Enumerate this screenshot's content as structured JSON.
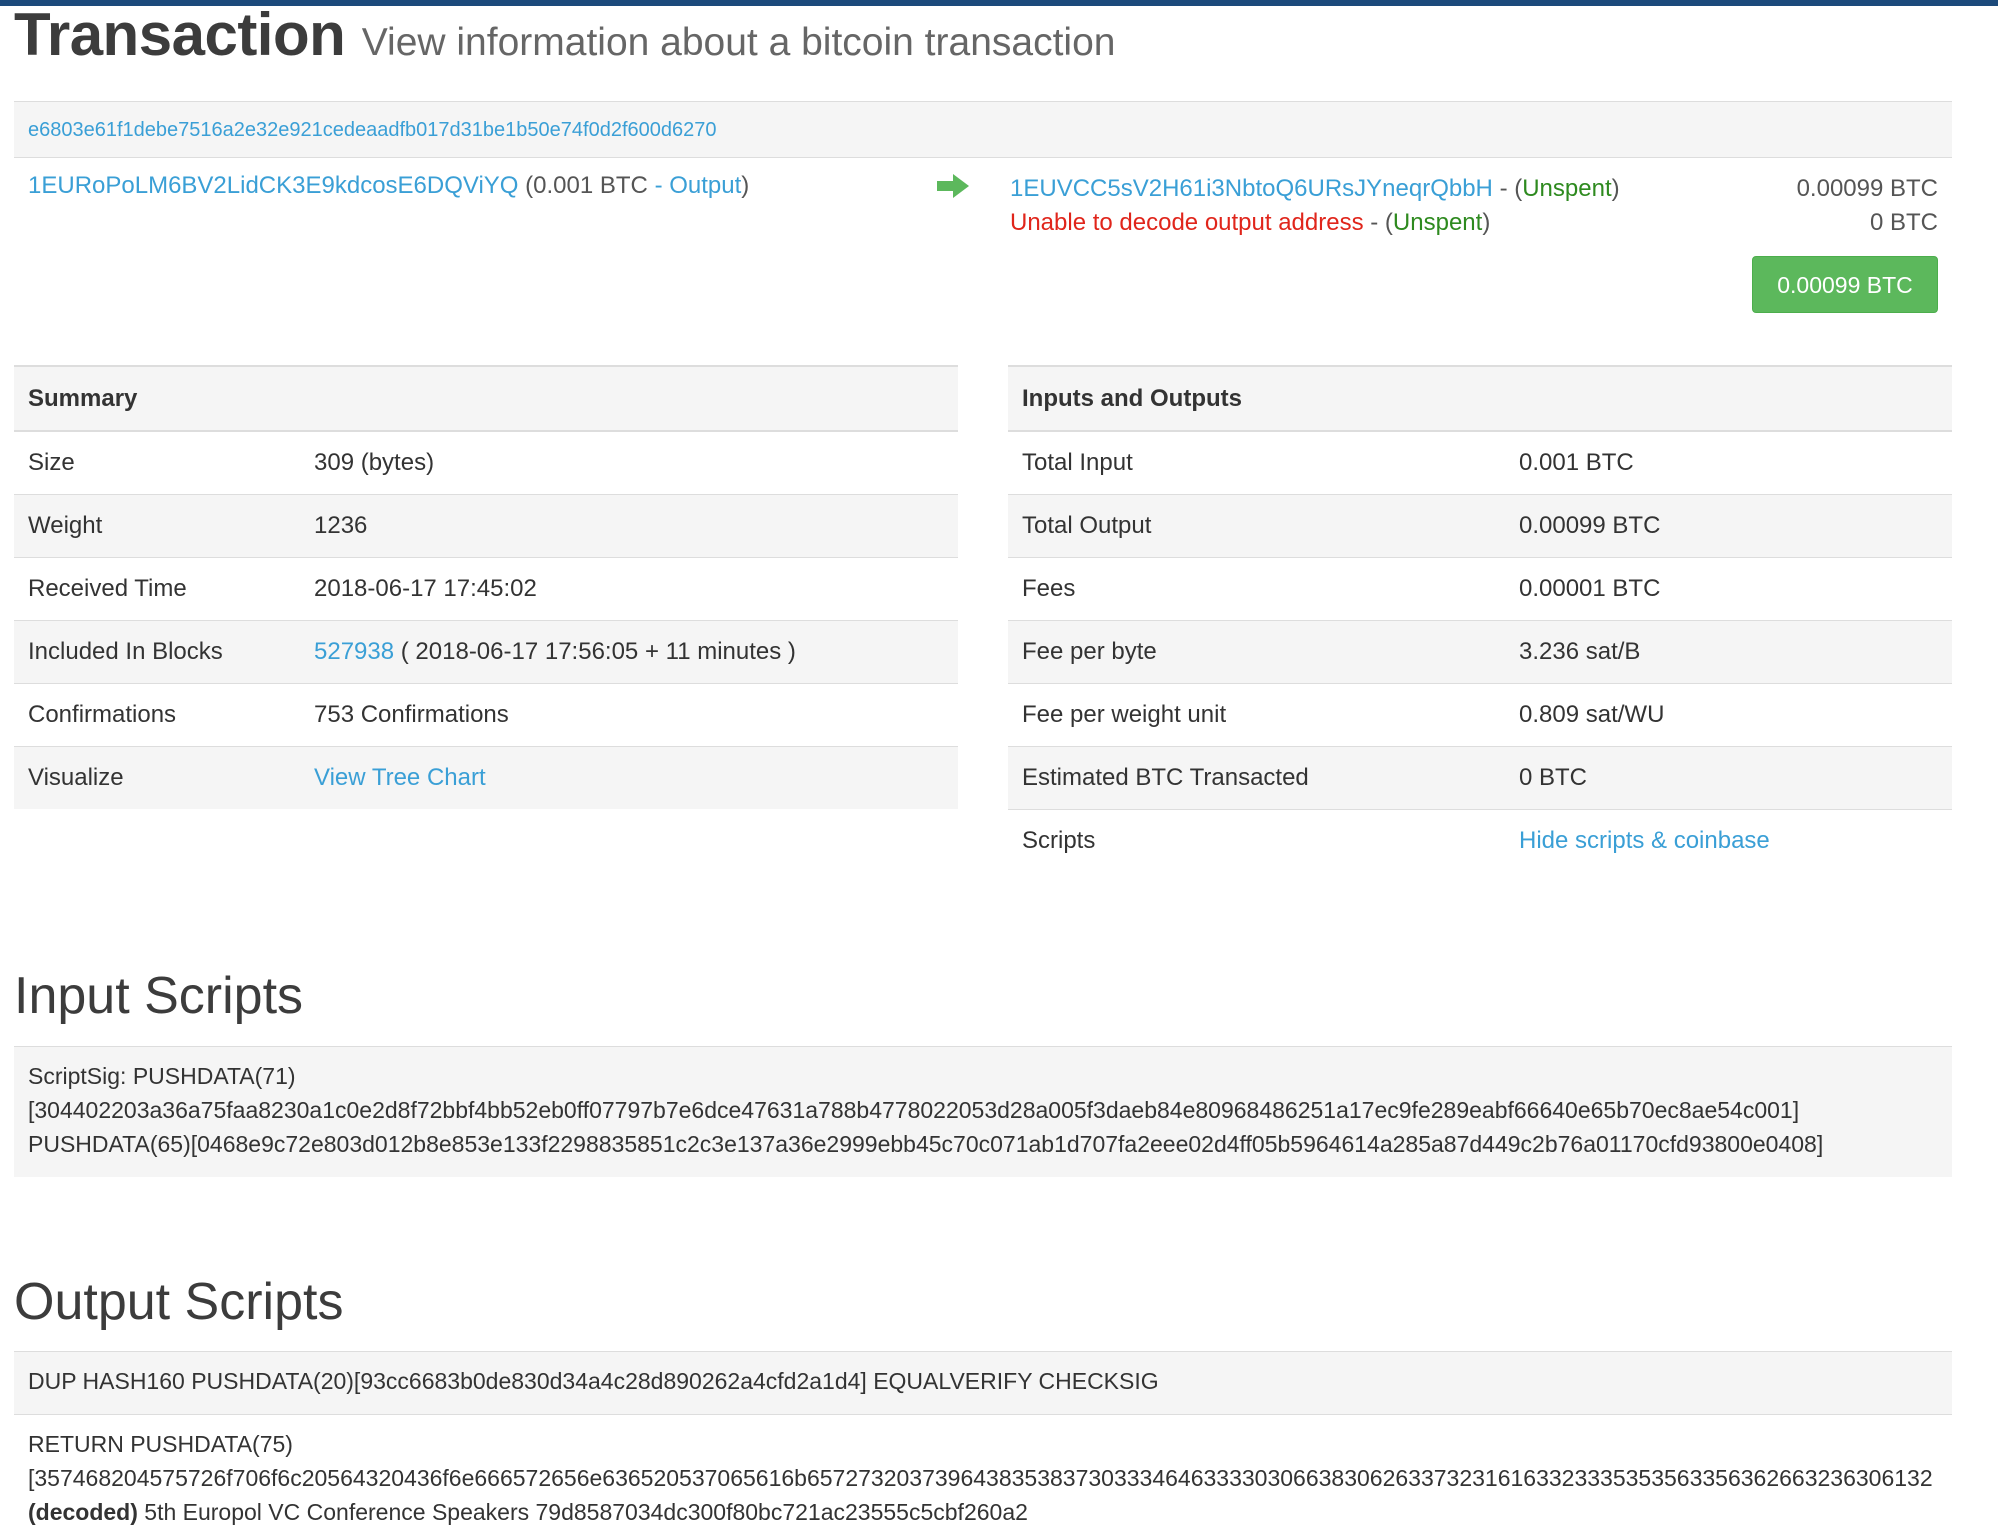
{
  "header": {
    "title": "Transaction",
    "subtitle": "View information about a bitcoin transaction"
  },
  "transaction": {
    "hash": "e6803e61f1debe7516a2e32e921cedeaadfb017d31be1b50e74f0d2f600d6270",
    "input": {
      "address": "1EURoPoLM6BV2LidCK3E9kdcosE6DQViYQ",
      "amount": "0.001 BTC",
      "separator": "-",
      "link_label": "Output",
      "open_paren": "(",
      "close_paren": ")"
    },
    "arrow_icon": "arrow-right-icon",
    "outputs": [
      {
        "address": "1EUVCC5sV2H61i3NbtoQ6URsJYneqrQbbH",
        "separator": "- (",
        "status": "Unspent",
        "close": ")",
        "amount": "0.00099 BTC"
      },
      {
        "address": "Unable to decode output address",
        "separator": "- (",
        "status": "Unspent",
        "close": ")",
        "amount": "0 BTC"
      }
    ],
    "total_button": "0.00099 BTC"
  },
  "summary": {
    "heading": "Summary",
    "rows": {
      "size": {
        "label": "Size",
        "value": "309 (bytes)"
      },
      "weight": {
        "label": "Weight",
        "value": "1236"
      },
      "received": {
        "label": "Received Time",
        "value": "2018-06-17 17:45:02"
      },
      "included": {
        "label": "Included In Blocks",
        "block": "527938",
        "value": "( 2018-06-17 17:56:05 + 11 minutes )"
      },
      "confirmations": {
        "label": "Confirmations",
        "value": "753 Confirmations"
      },
      "visualize": {
        "label": "Visualize",
        "link": "View Tree Chart"
      }
    }
  },
  "io": {
    "heading": "Inputs and Outputs",
    "rows": {
      "total_input": {
        "label": "Total Input",
        "value": "0.001 BTC"
      },
      "total_output": {
        "label": "Total Output",
        "value": "0.00099 BTC"
      },
      "fees": {
        "label": "Fees",
        "value": "0.00001 BTC"
      },
      "fee_byte": {
        "label": "Fee per byte",
        "value": "3.236 sat/B"
      },
      "fee_wu": {
        "label": "Fee per weight unit",
        "value": "0.809 sat/WU"
      },
      "estimated": {
        "label": "Estimated BTC Transacted",
        "value": "0 BTC"
      },
      "scripts": {
        "label": "Scripts",
        "link": "Hide scripts & coinbase"
      }
    }
  },
  "input_scripts": {
    "heading": "Input Scripts",
    "lines": [
      "ScriptSig: PUSHDATA(71)",
      "[304402203a36a75faa8230a1c0e2d8f72bbf4bb52eb0ff07797b7e6dce47631a788b4778022053d28a005f3daeb84e80968486251a17ec9fe289eabf66640e65b70ec8ae54c001]",
      "PUSHDATA(65)[0468e9c72e803d012b8e853e133f2298835851c2c3e137a36e2999ebb45c70c071ab1d707fa2eee02d4ff05b5964614a285a87d449c2b76a01170cfd93800e0408]"
    ]
  },
  "output_scripts": {
    "heading": "Output Scripts",
    "script1": "DUP HASH160 PUSHDATA(20)[93cc6683b0de830d34a4c28d890262a4cfd2a1d4] EQUALVERIFY CHECKSIG",
    "script2_line1": "RETURN PUSHDATA(75)",
    "script2_line2": "[357468204575726f706f6c20564320436f6e666572656e636520537065616b6572732037396438353837303334646333303066383062633732316163323335353563356362663236306132",
    "decoded_label": "(decoded)",
    "decoded_text": "5th Europol VC Conference Speakers 79d8587034dc300f80bc721ac23555c5cbf260a2"
  },
  "colors": {
    "link": "#3a9fd6",
    "unspent": "#2e8a1f",
    "error": "#e0251b",
    "button": "#5cb85c",
    "topbar": "#1c4a7b"
  }
}
